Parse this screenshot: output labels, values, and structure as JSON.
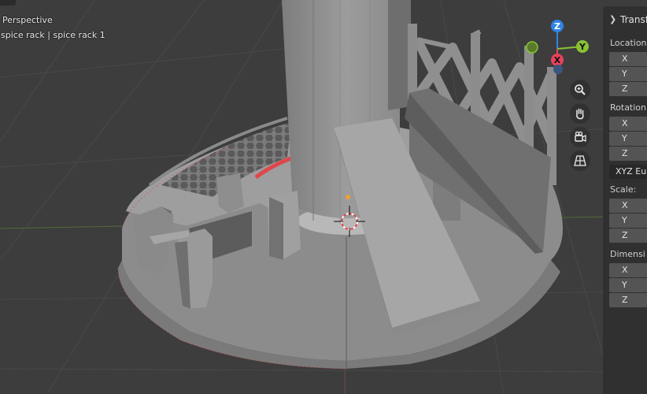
{
  "viewport": {
    "view_label": "Perspective",
    "object_label": "spice rack | spice rack 1"
  },
  "gizmo": {
    "axis_z": "Z",
    "axis_y": "Y",
    "axis_x": "X",
    "color_x": "#e8425b",
    "color_y": "#8bc234",
    "color_z": "#2f84e6"
  },
  "nav_icons": [
    "zoom-icon",
    "hand-pan-icon",
    "camera-icon",
    "grid-ortho-icon"
  ],
  "sidebar": {
    "header": "Transf",
    "location_label": "Location",
    "rotation_label": "Rotation:",
    "rotation_mode": "XYZ Eu",
    "scale_label": "Scale:",
    "dimensions_label": "Dimensi",
    "axis_x": "X",
    "axis_y": "Y",
    "axis_z": "Z"
  },
  "colors": {
    "viewport_bg": "#3d3d3d",
    "panel_bg": "#303030",
    "field_bg": "#545454",
    "model_gray": "#9a9a9a",
    "edge_red": "#e0464a",
    "origin_orange": "#f0a030"
  }
}
